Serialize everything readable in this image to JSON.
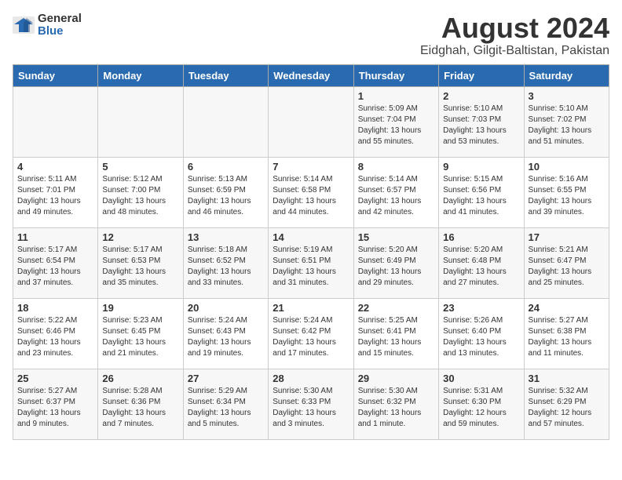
{
  "logo": {
    "general": "General",
    "blue": "Blue"
  },
  "title": "August 2024",
  "subtitle": "Eidghah, Gilgit-Baltistan, Pakistan",
  "days_of_week": [
    "Sunday",
    "Monday",
    "Tuesday",
    "Wednesday",
    "Thursday",
    "Friday",
    "Saturday"
  ],
  "weeks": [
    [
      {
        "day": "",
        "info": ""
      },
      {
        "day": "",
        "info": ""
      },
      {
        "day": "",
        "info": ""
      },
      {
        "day": "",
        "info": ""
      },
      {
        "day": "1",
        "info": "Sunrise: 5:09 AM\nSunset: 7:04 PM\nDaylight: 13 hours\nand 55 minutes."
      },
      {
        "day": "2",
        "info": "Sunrise: 5:10 AM\nSunset: 7:03 PM\nDaylight: 13 hours\nand 53 minutes."
      },
      {
        "day": "3",
        "info": "Sunrise: 5:10 AM\nSunset: 7:02 PM\nDaylight: 13 hours\nand 51 minutes."
      }
    ],
    [
      {
        "day": "4",
        "info": "Sunrise: 5:11 AM\nSunset: 7:01 PM\nDaylight: 13 hours\nand 49 minutes."
      },
      {
        "day": "5",
        "info": "Sunrise: 5:12 AM\nSunset: 7:00 PM\nDaylight: 13 hours\nand 48 minutes."
      },
      {
        "day": "6",
        "info": "Sunrise: 5:13 AM\nSunset: 6:59 PM\nDaylight: 13 hours\nand 46 minutes."
      },
      {
        "day": "7",
        "info": "Sunrise: 5:14 AM\nSunset: 6:58 PM\nDaylight: 13 hours\nand 44 minutes."
      },
      {
        "day": "8",
        "info": "Sunrise: 5:14 AM\nSunset: 6:57 PM\nDaylight: 13 hours\nand 42 minutes."
      },
      {
        "day": "9",
        "info": "Sunrise: 5:15 AM\nSunset: 6:56 PM\nDaylight: 13 hours\nand 41 minutes."
      },
      {
        "day": "10",
        "info": "Sunrise: 5:16 AM\nSunset: 6:55 PM\nDaylight: 13 hours\nand 39 minutes."
      }
    ],
    [
      {
        "day": "11",
        "info": "Sunrise: 5:17 AM\nSunset: 6:54 PM\nDaylight: 13 hours\nand 37 minutes."
      },
      {
        "day": "12",
        "info": "Sunrise: 5:17 AM\nSunset: 6:53 PM\nDaylight: 13 hours\nand 35 minutes."
      },
      {
        "day": "13",
        "info": "Sunrise: 5:18 AM\nSunset: 6:52 PM\nDaylight: 13 hours\nand 33 minutes."
      },
      {
        "day": "14",
        "info": "Sunrise: 5:19 AM\nSunset: 6:51 PM\nDaylight: 13 hours\nand 31 minutes."
      },
      {
        "day": "15",
        "info": "Sunrise: 5:20 AM\nSunset: 6:49 PM\nDaylight: 13 hours\nand 29 minutes."
      },
      {
        "day": "16",
        "info": "Sunrise: 5:20 AM\nSunset: 6:48 PM\nDaylight: 13 hours\nand 27 minutes."
      },
      {
        "day": "17",
        "info": "Sunrise: 5:21 AM\nSunset: 6:47 PM\nDaylight: 13 hours\nand 25 minutes."
      }
    ],
    [
      {
        "day": "18",
        "info": "Sunrise: 5:22 AM\nSunset: 6:46 PM\nDaylight: 13 hours\nand 23 minutes."
      },
      {
        "day": "19",
        "info": "Sunrise: 5:23 AM\nSunset: 6:45 PM\nDaylight: 13 hours\nand 21 minutes."
      },
      {
        "day": "20",
        "info": "Sunrise: 5:24 AM\nSunset: 6:43 PM\nDaylight: 13 hours\nand 19 minutes."
      },
      {
        "day": "21",
        "info": "Sunrise: 5:24 AM\nSunset: 6:42 PM\nDaylight: 13 hours\nand 17 minutes."
      },
      {
        "day": "22",
        "info": "Sunrise: 5:25 AM\nSunset: 6:41 PM\nDaylight: 13 hours\nand 15 minutes."
      },
      {
        "day": "23",
        "info": "Sunrise: 5:26 AM\nSunset: 6:40 PM\nDaylight: 13 hours\nand 13 minutes."
      },
      {
        "day": "24",
        "info": "Sunrise: 5:27 AM\nSunset: 6:38 PM\nDaylight: 13 hours\nand 11 minutes."
      }
    ],
    [
      {
        "day": "25",
        "info": "Sunrise: 5:27 AM\nSunset: 6:37 PM\nDaylight: 13 hours\nand 9 minutes."
      },
      {
        "day": "26",
        "info": "Sunrise: 5:28 AM\nSunset: 6:36 PM\nDaylight: 13 hours\nand 7 minutes."
      },
      {
        "day": "27",
        "info": "Sunrise: 5:29 AM\nSunset: 6:34 PM\nDaylight: 13 hours\nand 5 minutes."
      },
      {
        "day": "28",
        "info": "Sunrise: 5:30 AM\nSunset: 6:33 PM\nDaylight: 13 hours\nand 3 minutes."
      },
      {
        "day": "29",
        "info": "Sunrise: 5:30 AM\nSunset: 6:32 PM\nDaylight: 13 hours\nand 1 minute."
      },
      {
        "day": "30",
        "info": "Sunrise: 5:31 AM\nSunset: 6:30 PM\nDaylight: 12 hours\nand 59 minutes."
      },
      {
        "day": "31",
        "info": "Sunrise: 5:32 AM\nSunset: 6:29 PM\nDaylight: 12 hours\nand 57 minutes."
      }
    ]
  ]
}
